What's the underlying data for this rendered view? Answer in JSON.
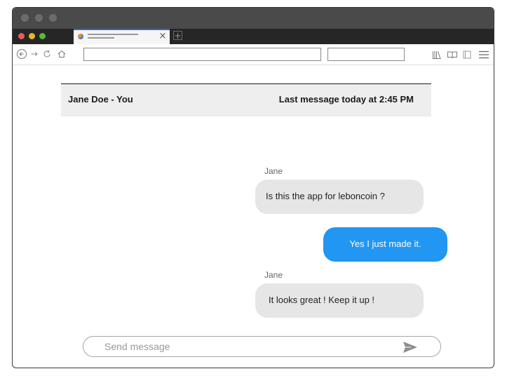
{
  "browser": {
    "window_controls": [
      "close-dot",
      "minimize-dot",
      "zoom-dot"
    ],
    "tab": {
      "icon": "firefox-icon",
      "close_symbol": "×"
    },
    "new_tab_symbol": "+",
    "toolbar_icons": [
      "back-icon",
      "forward-icon",
      "reload-icon",
      "home-icon",
      "library-icon",
      "reader-icon",
      "sidebar-icon",
      "menu-icon"
    ],
    "colors": {
      "titlebar": "#4a4a4a",
      "tabstrip": "#262626",
      "tab_accent": "#2a6bd1"
    }
  },
  "chat": {
    "header": {
      "participants": "Jane Doe - You",
      "last_message": "Last message today at 2:45 PM"
    },
    "messages": [
      {
        "sender": "Jane",
        "text": "Is this the app for leboncoin ?",
        "direction": "incoming"
      },
      {
        "sender": "",
        "text": "Yes I just made it.",
        "direction": "outgoing"
      },
      {
        "sender": "Jane",
        "text": "It looks great ! Keep it up !",
        "direction": "incoming"
      }
    ],
    "composer": {
      "placeholder": "Send message",
      "send_icon": "send-icon"
    },
    "colors": {
      "incoming_bubble": "#e6e6e7",
      "outgoing_bubble": "#2196f3",
      "header_bg": "#eeeeee"
    }
  }
}
